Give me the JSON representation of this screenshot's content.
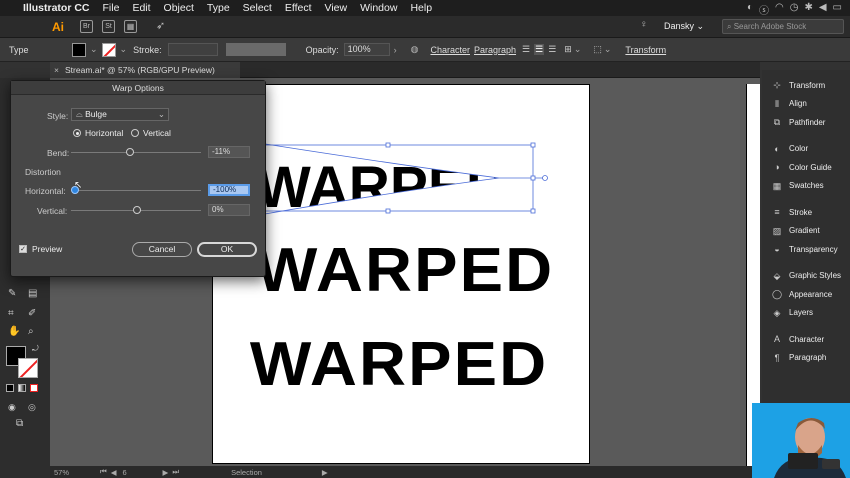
{
  "menubar": {
    "apple": "",
    "app": "Illustrator CC",
    "items": [
      "File",
      "Edit",
      "Object",
      "Type",
      "Select",
      "Effect",
      "View",
      "Window",
      "Help"
    ]
  },
  "appbar": {
    "logo": "Ai",
    "user": "Dansky",
    "search_placeholder": "Search Adobe Stock"
  },
  "control": {
    "type_label": "Type",
    "stroke_label": "Stroke:",
    "opacity_label": "Opacity:",
    "opacity_value": "100%",
    "character": "Character",
    "paragraph": "Paragraph",
    "transform": "Transform"
  },
  "doc_tab": {
    "title": "Stream.ai* @ 57% (RGB/GPU Preview)",
    "close": "×"
  },
  "artboard_text": {
    "warped": "WARPED",
    "line2": "WARPED",
    "line3": "WARPED"
  },
  "dialog": {
    "title": "Warp Options",
    "style_label": "Style:",
    "style_value": "Bulge",
    "orientation_horizontal": "Horizontal",
    "orientation_vertical": "Vertical",
    "orientation_selected": "Horizontal",
    "bend_label": "Bend:",
    "bend_value": "-11%",
    "bend_level": -11,
    "distortion_heading": "Distortion",
    "dist_h_label": "Horizontal:",
    "dist_h_value": "-100%",
    "dist_h_level": -100,
    "dist_v_label": "Vertical:",
    "dist_v_value": "0%",
    "dist_v_level": 0,
    "preview_label": "Preview",
    "preview_checked": true,
    "cancel": "Cancel",
    "ok": "OK"
  },
  "right_panel": {
    "groups": [
      [
        "Transform",
        "Align",
        "Pathfinder"
      ],
      [
        "Color",
        "Color Guide",
        "Swatches"
      ],
      [
        "Stroke",
        "Gradient",
        "Transparency"
      ],
      [
        "Graphic Styles",
        "Appearance",
        "Layers"
      ],
      [
        "Character",
        "Paragraph"
      ]
    ]
  },
  "status": {
    "zoom": "57%",
    "page": "6",
    "tool": "Selection"
  }
}
